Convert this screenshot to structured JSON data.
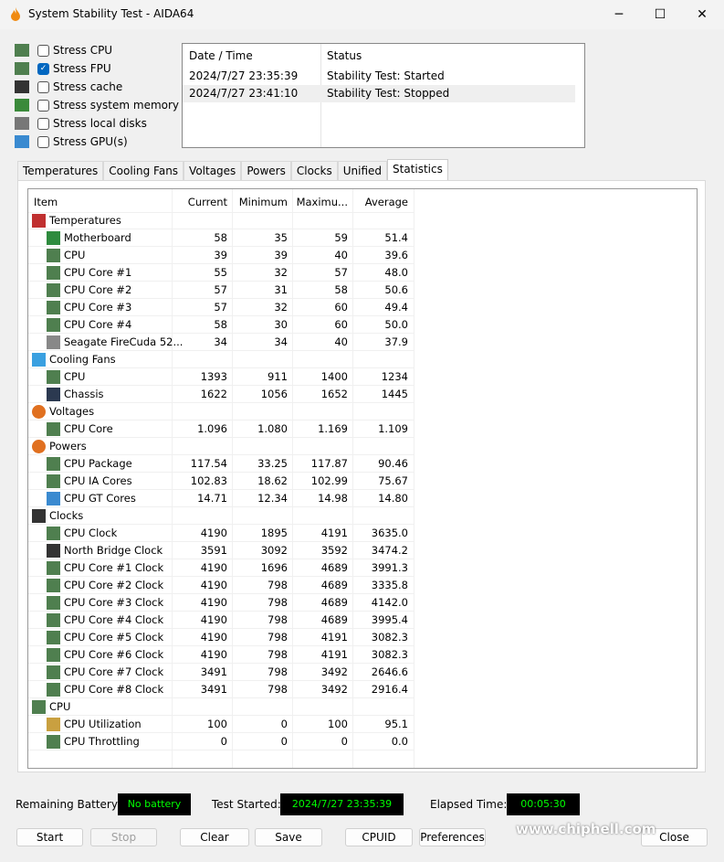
{
  "window": {
    "title": "System Stability Test - AIDA64",
    "minimize": "─",
    "maximize": "☐",
    "close": "✕"
  },
  "stress_options": [
    {
      "label": "Stress CPU",
      "checked": false,
      "icon": "cpu-chip-icon"
    },
    {
      "label": "Stress FPU",
      "checked": true,
      "icon": "fpu-chip-icon"
    },
    {
      "label": "Stress cache",
      "checked": false,
      "icon": "cache-chip-icon"
    },
    {
      "label": "Stress system memory",
      "checked": false,
      "icon": "memory-module-icon"
    },
    {
      "label": "Stress local disks",
      "checked": false,
      "icon": "disk-drive-icon"
    },
    {
      "label": "Stress GPU(s)",
      "checked": false,
      "icon": "gpu-monitor-icon"
    }
  ],
  "log": {
    "headers": [
      "Date / Time",
      "Status"
    ],
    "rows": [
      [
        "2024/7/27 23:35:39",
        "Stability Test: Started"
      ],
      [
        "2024/7/27 23:41:10",
        "Stability Test: Stopped"
      ]
    ]
  },
  "tabs": [
    "Temperatures",
    "Cooling Fans",
    "Voltages",
    "Powers",
    "Clocks",
    "Unified",
    "Statistics"
  ],
  "active_tab": "Statistics",
  "table": {
    "headers": [
      "Item",
      "Current",
      "Minimum",
      "Maximu...",
      "Average"
    ],
    "rows": [
      {
        "group": true,
        "icon": "thermometer-icon",
        "name": "Temperatures"
      },
      {
        "icon": "motherboard-icon",
        "name": "Motherboard",
        "v": [
          "58",
          "35",
          "59",
          "51.4"
        ]
      },
      {
        "icon": "cpu-icon",
        "name": "CPU",
        "v": [
          "39",
          "39",
          "40",
          "39.6"
        ]
      },
      {
        "icon": "cpu-icon",
        "name": "CPU Core #1",
        "v": [
          "55",
          "32",
          "57",
          "48.0"
        ]
      },
      {
        "icon": "cpu-icon",
        "name": "CPU Core #2",
        "v": [
          "57",
          "31",
          "58",
          "50.6"
        ]
      },
      {
        "icon": "cpu-icon",
        "name": "CPU Core #3",
        "v": [
          "57",
          "32",
          "60",
          "49.4"
        ]
      },
      {
        "icon": "cpu-icon",
        "name": "CPU Core #4",
        "v": [
          "58",
          "30",
          "60",
          "50.0"
        ]
      },
      {
        "icon": "disk-icon",
        "name": "Seagate FireCuda 52...",
        "v": [
          "34",
          "34",
          "40",
          "37.9"
        ]
      },
      {
        "group": true,
        "icon": "fan-icon",
        "name": "Cooling Fans"
      },
      {
        "icon": "cpu-icon",
        "name": "CPU",
        "v": [
          "1393",
          "911",
          "1400",
          "1234"
        ]
      },
      {
        "icon": "chassis-icon",
        "name": "Chassis",
        "v": [
          "1622",
          "1056",
          "1652",
          "1445"
        ]
      },
      {
        "group": true,
        "icon": "voltage-icon",
        "name": "Voltages"
      },
      {
        "icon": "cpu-icon",
        "name": "CPU Core",
        "v": [
          "1.096",
          "1.080",
          "1.169",
          "1.109"
        ]
      },
      {
        "group": true,
        "icon": "power-icon",
        "name": "Powers"
      },
      {
        "icon": "cpu-icon",
        "name": "CPU Package",
        "v": [
          "117.54",
          "33.25",
          "117.87",
          "90.46"
        ]
      },
      {
        "icon": "cpu-icon",
        "name": "CPU IA Cores",
        "v": [
          "102.83",
          "18.62",
          "102.99",
          "75.67"
        ]
      },
      {
        "icon": "gpu-icon",
        "name": "CPU GT Cores",
        "v": [
          "14.71",
          "12.34",
          "14.98",
          "14.80"
        ]
      },
      {
        "group": true,
        "icon": "clock-chip-icon",
        "name": "Clocks"
      },
      {
        "icon": "cpu-icon",
        "name": "CPU Clock",
        "v": [
          "4190",
          "1895",
          "4191",
          "3635.0"
        ]
      },
      {
        "icon": "chip-icon",
        "name": "North Bridge Clock",
        "v": [
          "3591",
          "3092",
          "3592",
          "3474.2"
        ]
      },
      {
        "icon": "cpu-icon",
        "name": "CPU Core #1 Clock",
        "v": [
          "4190",
          "1696",
          "4689",
          "3991.3"
        ]
      },
      {
        "icon": "cpu-icon",
        "name": "CPU Core #2 Clock",
        "v": [
          "4190",
          "798",
          "4689",
          "3335.8"
        ]
      },
      {
        "icon": "cpu-icon",
        "name": "CPU Core #3 Clock",
        "v": [
          "4190",
          "798",
          "4689",
          "4142.0"
        ]
      },
      {
        "icon": "cpu-icon",
        "name": "CPU Core #4 Clock",
        "v": [
          "4190",
          "798",
          "4689",
          "3995.4"
        ]
      },
      {
        "icon": "cpu-icon",
        "name": "CPU Core #5 Clock",
        "v": [
          "4190",
          "798",
          "4191",
          "3082.3"
        ]
      },
      {
        "icon": "cpu-icon",
        "name": "CPU Core #6 Clock",
        "v": [
          "4190",
          "798",
          "4191",
          "3082.3"
        ]
      },
      {
        "icon": "cpu-icon",
        "name": "CPU Core #7 Clock",
        "v": [
          "3491",
          "798",
          "3492",
          "2646.6"
        ]
      },
      {
        "icon": "cpu-icon",
        "name": "CPU Core #8 Clock",
        "v": [
          "3491",
          "798",
          "3492",
          "2916.4"
        ]
      },
      {
        "group": true,
        "icon": "cpu-icon",
        "name": "CPU"
      },
      {
        "icon": "hourglass-icon",
        "name": "CPU Utilization",
        "v": [
          "100",
          "0",
          "100",
          "95.1"
        ]
      },
      {
        "icon": "cpu-icon",
        "name": "CPU Throttling",
        "v": [
          "0",
          "0",
          "0",
          "0.0"
        ]
      }
    ]
  },
  "status": {
    "battery_label": "Remaining Battery:",
    "battery_value": "No battery",
    "started_label": "Test Started:",
    "started_value": "2024/7/27 23:35:39",
    "elapsed_label": "Elapsed Time:",
    "elapsed_value": "00:05:30"
  },
  "buttons": {
    "start": "Start",
    "stop": "Stop",
    "clear": "Clear",
    "save": "Save",
    "cpuid": "CPUID",
    "preferences": "Preferences",
    "close": "Close"
  },
  "watermark": "www.chiphell.com",
  "colors": {
    "lcd_bg": "#000000",
    "lcd_text": "#00ff00",
    "checkbox_accent": "#0067c0"
  }
}
